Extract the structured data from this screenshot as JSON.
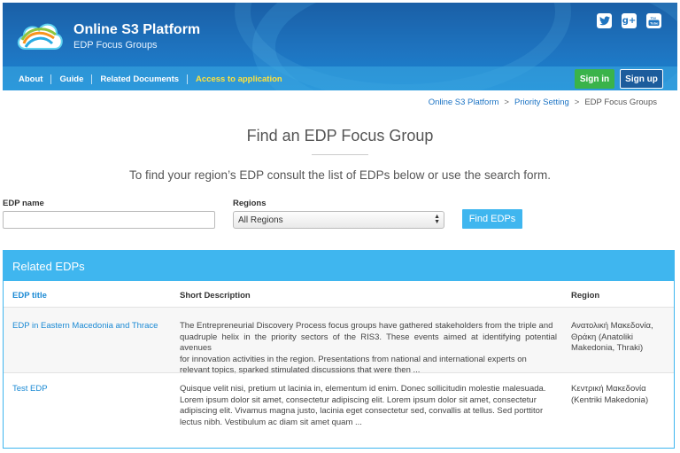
{
  "header": {
    "title": "Online S3 Platform",
    "subtitle": "EDP Focus Groups",
    "social_icons": [
      "twitter-icon",
      "google-plus-icon",
      "youtube-icon"
    ],
    "nav": [
      {
        "label": "About"
      },
      {
        "label": "Guide"
      },
      {
        "label": "Related Documents"
      },
      {
        "label": "Access to application"
      }
    ],
    "signin_label": "Sign in",
    "signup_label": "Sign up",
    "colors": {
      "header_blue": "#1e74c0",
      "accent_yellow": "#ffe23a",
      "signin_green": "#3ab34a",
      "light_blue": "#3fb6ef"
    }
  },
  "breadcrumb": {
    "items": [
      "Online S3 Platform",
      "Priority Setting",
      "EDP Focus Groups"
    ],
    "separator": ">"
  },
  "page": {
    "title": "Find an EDP Focus Group",
    "intro": "To find your region’s EDP consult the list of EDPs below or use the search form."
  },
  "search": {
    "name_label": "EDP name",
    "name_value": "",
    "regions_label": "Regions",
    "regions_selected": "All Regions",
    "find_label": "Find EDPs"
  },
  "results": {
    "panel_title": "Related EDPs",
    "columns": [
      "EDP title",
      "Short Description",
      "Region"
    ],
    "rows": [
      {
        "title": "EDP in Eastern Macedonia and Thrace",
        "desc": [
          "The Entrepreneurial Discovery Process focus groups have gathered stakeholders from the triple and",
          "quadruple helix in the priority sectors of the RIS3. These events aimed at identifying potential avenues",
          "for innovation activities in the region. Presentations from national and international experts on",
          "relevant topics, sparked stimulated discussions that were then ..."
        ],
        "region": [
          "Ανατολική Μακεδονία,",
          "Θράκη (Anatoliki",
          "Makedonia, Thraki)"
        ]
      },
      {
        "title": "Test EDP",
        "desc": [
          "Quisque velit nisi, pretium ut lacinia in, elementum id enim. Donec sollicitudin molestie malesuada.",
          "Lorem ipsum dolor sit amet, consectetur adipiscing elit. Lorem ipsum dolor sit amet, consectetur",
          "adipiscing elit. Vivamus magna justo, lacinia eget consectetur sed, convallis at tellus. Sed porttitor",
          "lectus nibh. Vestibulum ac diam sit amet quam ..."
        ],
        "region": [
          "Κεντρική Μακεδονία",
          "(Kentriki Makedonia)"
        ]
      }
    ]
  }
}
